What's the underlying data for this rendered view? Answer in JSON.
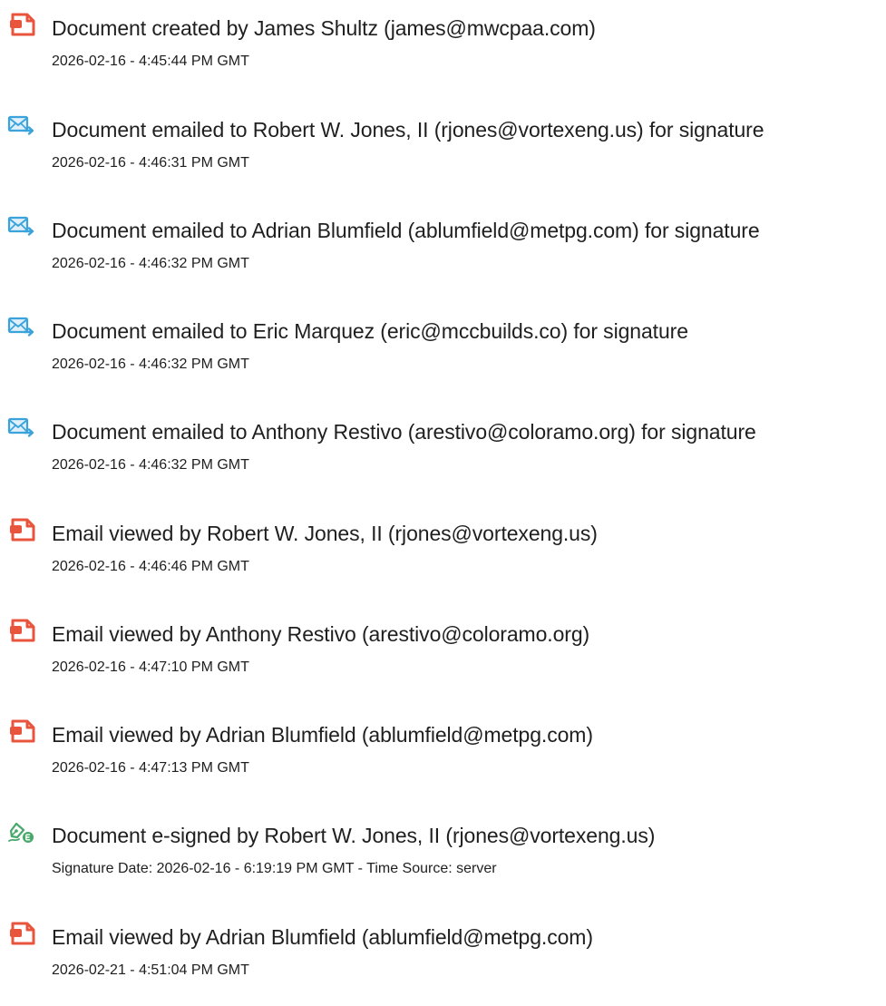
{
  "colors": {
    "doc_icon": "#e8543c",
    "mail_icon": "#3aa3dc",
    "sign_icon": "#47a86b",
    "text": "#1f1f1f"
  },
  "events": [
    {
      "icon": "document-icon",
      "title": "Document created by James Shultz (james@mwcpaa.com)",
      "timestamp": "2026-02-16 - 4:45:44 PM GMT"
    },
    {
      "icon": "email-sent-icon",
      "title": "Document emailed to Robert W. Jones, II (rjones@vortexeng.us) for signature",
      "timestamp": "2026-02-16 - 4:46:31 PM GMT"
    },
    {
      "icon": "email-sent-icon",
      "title": "Document emailed to Adrian Blumfield (ablumfield@metpg.com) for signature",
      "timestamp": "2026-02-16 - 4:46:32 PM GMT"
    },
    {
      "icon": "email-sent-icon",
      "title": "Document emailed to Eric Marquez (eric@mccbuilds.co) for signature",
      "timestamp": "2026-02-16 - 4:46:32 PM GMT"
    },
    {
      "icon": "email-sent-icon",
      "title": "Document emailed to Anthony Restivo (arestivo@coloramo.org) for signature",
      "timestamp": "2026-02-16 - 4:46:32 PM GMT"
    },
    {
      "icon": "document-icon",
      "title": "Email viewed by Robert W. Jones, II (rjones@vortexeng.us)",
      "timestamp": "2026-02-16 - 4:46:46 PM GMT"
    },
    {
      "icon": "document-icon",
      "title": "Email viewed by Anthony Restivo (arestivo@coloramo.org)",
      "timestamp": "2026-02-16 - 4:47:10 PM GMT"
    },
    {
      "icon": "document-icon",
      "title": "Email viewed by Adrian Blumfield (ablumfield@metpg.com)",
      "timestamp": "2026-02-16 - 4:47:13 PM GMT"
    },
    {
      "icon": "e-signature-icon",
      "title": "Document e-signed by Robert W. Jones, II (rjones@vortexeng.us)",
      "timestamp": "Signature Date: 2026-02-16 - 6:19:19 PM GMT - Time Source: server"
    },
    {
      "icon": "document-icon",
      "title": "Email viewed by Adrian Blumfield (ablumfield@metpg.com)",
      "timestamp": "2026-02-21 - 4:51:04 PM GMT"
    }
  ]
}
